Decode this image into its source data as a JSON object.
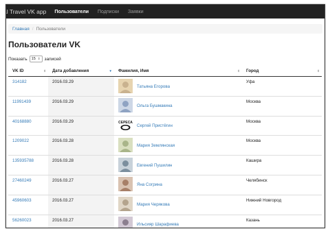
{
  "navbar": {
    "brand": "al Travel VK app",
    "items": [
      {
        "label": "Пользователи",
        "active": true
      },
      {
        "label": "Подписки",
        "active": false
      },
      {
        "label": "Заявки",
        "active": false
      }
    ]
  },
  "breadcrumb": {
    "home": "Главная",
    "sep": "/",
    "current": "Пользователи"
  },
  "page_title": "Пользователи VK",
  "length_control": {
    "before": "Показать",
    "value": "15",
    "after": "записей"
  },
  "table": {
    "headers": [
      "VK ID",
      "Дата добавления",
      "Фамилия, Имя",
      "Город"
    ],
    "rows": [
      {
        "id": "314182",
        "date": "2016.03.29",
        "name": "Татьяна Егорова",
        "city": "Уфа",
        "avatar": "avatar-photo"
      },
      {
        "id": "11991439",
        "date": "2016.03.29",
        "name": "Ольга Бушмакина",
        "city": "Москва",
        "avatar": "avatar-photo"
      },
      {
        "id": "40168880",
        "date": "2016.03.29",
        "name": "Сергей Пристёгин",
        "city": "Москва",
        "avatar": "avatar-logo"
      },
      {
        "id": "1209022",
        "date": "2016.03.28",
        "name": "Мария Землянская",
        "city": "Москва",
        "avatar": "avatar-photo"
      },
      {
        "id": "135935788",
        "date": "2016.03.28",
        "name": "Евгений Пушилин",
        "city": "Кашира",
        "avatar": "avatar-photo"
      },
      {
        "id": "27460249",
        "date": "2016.03.27",
        "name": "Яна Согрина",
        "city": "Челябинск",
        "avatar": "avatar-photo"
      },
      {
        "id": "45960603",
        "date": "2016.03.27",
        "name": "Мария Черякова",
        "city": "Нижний Новгород",
        "avatar": "avatar-photo"
      },
      {
        "id": "56260023",
        "date": "2016.03.27",
        "name": "Ильсияр Шарафиева",
        "city": "Казань",
        "avatar": "avatar-photo"
      }
    ]
  },
  "colors": {
    "navbar": "#222222",
    "link": "#337ab7",
    "sorted_column": "#f3f3f3"
  }
}
